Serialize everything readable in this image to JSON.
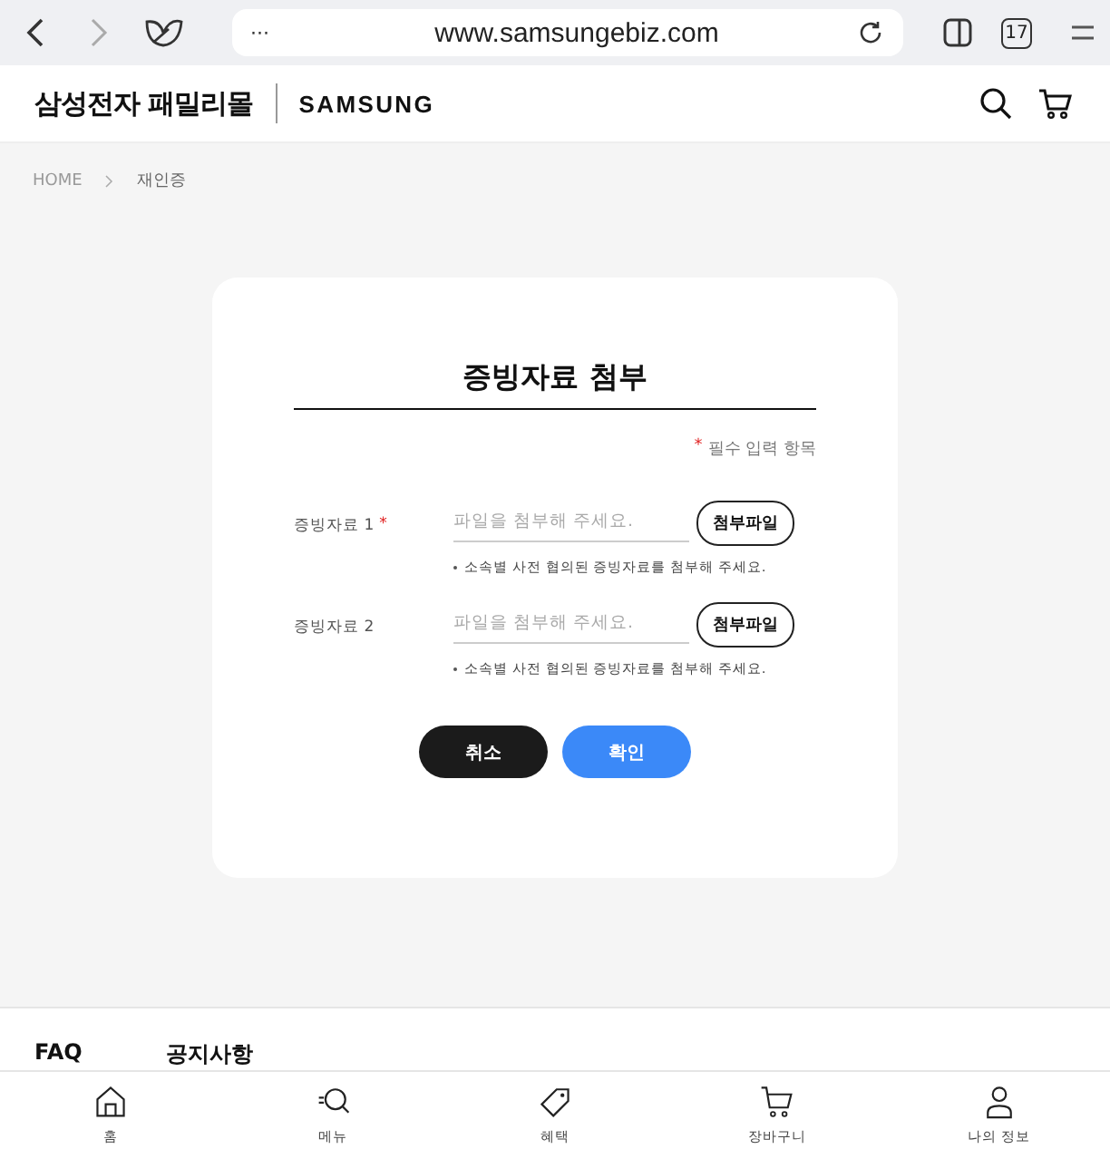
{
  "browser": {
    "url": "www.samsungebiz.com",
    "tab_count": "17",
    "more": "···"
  },
  "header": {
    "brand": "삼성전자 패밀리몰",
    "logo": "SAMSUNG"
  },
  "breadcrumb": [
    "HOME",
    "재인증"
  ],
  "form": {
    "title": "증빙자료 첨부",
    "required_note": {
      "mark": "*",
      "text": "필수 입력 항목"
    },
    "fields": [
      {
        "label": "증빙자료 1",
        "required_mark": "*",
        "placeholder": "파일을 첨부해 주세요.",
        "button": "첨부파일",
        "hint": "소속별 사전 협의된 증빙자료를 첨부해 주세요."
      },
      {
        "label": "증빙자료 2",
        "placeholder": "파일을 첨부해 주세요.",
        "button": "첨부파일",
        "hint": "소속별 사전 협의된 증빙자료를 첨부해 주세요."
      }
    ]
  },
  "actions": [
    {
      "label": "취소",
      "kind": "secondary"
    },
    {
      "label": "확인",
      "kind": "primary"
    }
  ],
  "footer_links": [
    "FAQ",
    "공지사항"
  ],
  "bottom_nav": [
    {
      "label": "홈",
      "kind": "home"
    },
    {
      "label": "메뉴",
      "kind": "menu"
    },
    {
      "label": "혜택",
      "kind": "tag"
    },
    {
      "label": "장바구니",
      "kind": "cart"
    },
    {
      "label": "나의 정보",
      "kind": "person"
    }
  ]
}
